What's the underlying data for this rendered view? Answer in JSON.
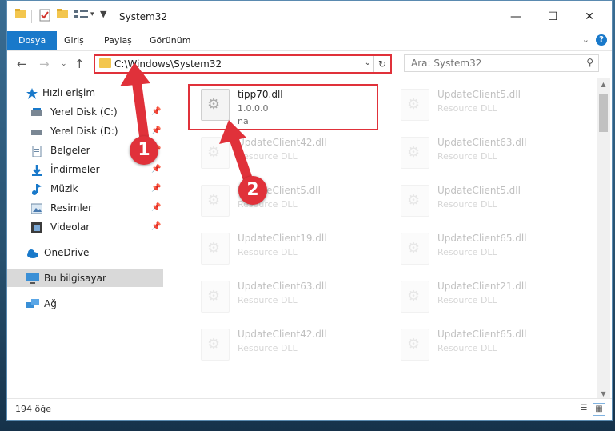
{
  "window": {
    "title": "System32",
    "controls": {
      "minimize": "—",
      "maximize": "☐",
      "close": "✕"
    }
  },
  "ribbon": {
    "tabs": [
      {
        "label": "Dosya"
      },
      {
        "label": "Giriş"
      },
      {
        "label": "Paylaş"
      },
      {
        "label": "Görünüm"
      }
    ],
    "help": "?"
  },
  "nav": {
    "address": "C:\\Windows\\System32",
    "search_placeholder": "Ara: System32"
  },
  "sidebar": {
    "items": [
      {
        "label": "Hızlı erişim",
        "icon": "star-icon"
      },
      {
        "label": "Yerel Disk (C:)",
        "icon": "drive-icon",
        "pinned": true
      },
      {
        "label": "Yerel Disk (D:)",
        "icon": "drive-icon",
        "pinned": true
      },
      {
        "label": "Belgeler",
        "icon": "document-icon",
        "pinned": true
      },
      {
        "label": "İndirmeler",
        "icon": "download-icon",
        "pinned": true
      },
      {
        "label": "Müzik",
        "icon": "music-icon",
        "pinned": true
      },
      {
        "label": "Resimler",
        "icon": "pictures-icon",
        "pinned": true
      },
      {
        "label": "Videolar",
        "icon": "video-icon",
        "pinned": true
      },
      {
        "label": "OneDrive",
        "icon": "cloud-icon"
      },
      {
        "label": "Bu bilgisayar",
        "icon": "computer-icon",
        "selected": true
      },
      {
        "label": "Ağ",
        "icon": "network-icon"
      }
    ]
  },
  "files": [
    {
      "name": "tipp70.dll",
      "version": "1.0.0.0",
      "desc": "na",
      "highlight": true
    },
    {
      "name": "UpdateClient5.dll",
      "desc": "Resource DLL"
    },
    {
      "name": "UpdateClient42.dll",
      "desc": "Resource DLL"
    },
    {
      "name": "UpdateClient63.dll",
      "desc": "Resource DLL"
    },
    {
      "name": "UpdateClient5.dll",
      "desc": "Resource DLL"
    },
    {
      "name": "UpdateClient5.dll",
      "desc": "Resource DLL"
    },
    {
      "name": "UpdateClient19.dll",
      "desc": "Resource DLL"
    },
    {
      "name": "UpdateClient65.dll",
      "desc": "Resource DLL"
    },
    {
      "name": "UpdateClient63.dll",
      "desc": "Resource DLL"
    },
    {
      "name": "UpdateClient21.dll",
      "desc": "Resource DLL"
    },
    {
      "name": "UpdateClient42.dll",
      "desc": "Resource DLL"
    },
    {
      "name": "UpdateClient65.dll",
      "desc": "Resource DLL"
    }
  ],
  "status": {
    "count": "194 öğe"
  },
  "callouts": {
    "one": "1",
    "two": "2"
  },
  "colors": {
    "accent": "#1979ca",
    "highlight": "#e0313a",
    "folder": "#f3c64e"
  }
}
